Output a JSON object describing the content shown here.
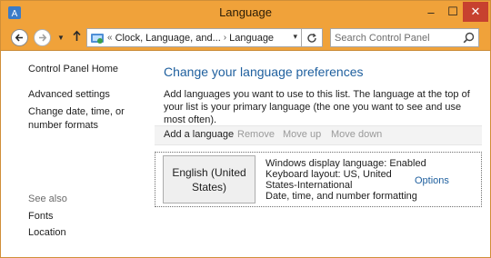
{
  "window": {
    "title": "Language",
    "controls": {
      "minimize": "–",
      "maximize": "☐",
      "close": "✕"
    }
  },
  "nav": {
    "back_icon": "arrow-left-icon",
    "forward_icon": "arrow-right-icon",
    "up_icon": "arrow-up-icon",
    "breadcrumb_overflow": "«",
    "breadcrumb": [
      "Clock, Language, and...",
      "Language"
    ],
    "breadcrumb_separator": "›",
    "search": {
      "placeholder": "Search Control Panel"
    }
  },
  "sidebar": {
    "home": "Control Panel Home",
    "links": [
      "Advanced settings",
      "Change date, time, or number formats"
    ],
    "see_also": "See also",
    "see_also_links": [
      "Fonts",
      "Location"
    ]
  },
  "main": {
    "title": "Change your language preferences",
    "description": "Add languages you want to use to this list. The language at the top of your list is your primary language (the one you want to see and use most often).",
    "toolbar": {
      "add": "Add a language",
      "remove": "Remove",
      "move_up": "Move up",
      "move_down": "Move down"
    },
    "languages": [
      {
        "name": "English (United States)",
        "details": [
          "Windows display language: Enabled",
          "Keyboard layout: US, United",
          "States-International",
          "Date, time, and number formatting"
        ],
        "options": "Options"
      }
    ]
  },
  "colors": {
    "title_bar": "#f0a23a",
    "link_blue": "#1e5f9e",
    "close_button": "#c7412f"
  }
}
